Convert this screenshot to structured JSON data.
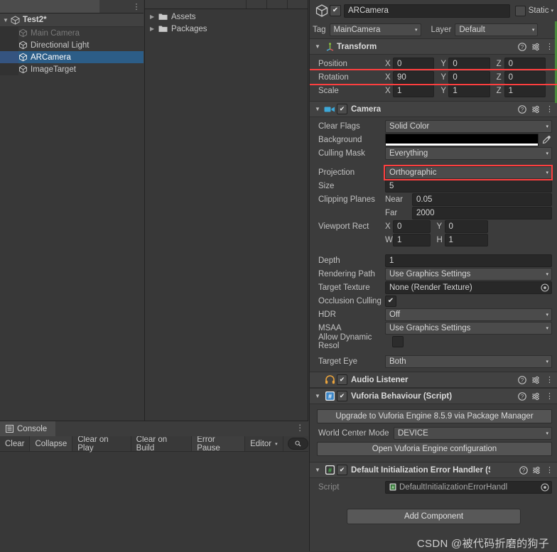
{
  "hierarchy": {
    "scene": {
      "name": "Test2*",
      "foldout": "▼",
      "icon": "unity-scene-icon",
      "menu": "⋮"
    },
    "items": [
      {
        "label": "Main Camera",
        "icon": "gameobject-cube-icon",
        "state": "disabled"
      },
      {
        "label": "Directional Light",
        "icon": "gameobject-cube-icon",
        "state": "normal"
      },
      {
        "label": "ARCamera",
        "icon": "gameobject-cube-icon",
        "state": "selected"
      },
      {
        "label": "ImageTarget",
        "icon": "gameobject-cube-icon",
        "state": "normal"
      }
    ]
  },
  "project": {
    "items": [
      {
        "label": "Assets",
        "arrow": "▶",
        "icon": "folder-icon"
      },
      {
        "label": "Packages",
        "arrow": "▶",
        "icon": "folder-icon"
      }
    ]
  },
  "console": {
    "tab_label": "Console",
    "tab_icon": "console-icon",
    "menu": "⋮",
    "buttons": [
      {
        "label": "Clear",
        "style": "flat"
      },
      {
        "label": "Collapse",
        "style": "raised"
      },
      {
        "label": "Clear on Play",
        "style": "flat"
      },
      {
        "label": "Clear on Build",
        "style": "flat"
      },
      {
        "label": "Error Pause",
        "style": "raised"
      },
      {
        "label": "Editor",
        "style": "flat",
        "caret": "▾"
      }
    ],
    "search_placeholder": "",
    "search_icon": "search-icon"
  },
  "inspector": {
    "gameobject": {
      "name": "ARCamera",
      "enabled_check": "✔",
      "icon": "gameobject-cube-icon",
      "static_label": "Static",
      "static_caret": "▾",
      "tag_label": "Tag",
      "tag_value": "MainCamera",
      "layer_label": "Layer",
      "layer_value": "Default",
      "caret": "▾"
    },
    "components": [
      {
        "name": "Transform",
        "icon": "transform-icon",
        "foldout": "▼",
        "has_enable_check": false,
        "help": "?",
        "preset": "preset-icon",
        "menu": "⋮",
        "rows": [
          {
            "type": "vector3",
            "label": "Position",
            "axes": [
              "X",
              "Y",
              "Z"
            ],
            "values": [
              "0",
              "0",
              "0"
            ],
            "highlight": false
          },
          {
            "type": "vector3",
            "label": "Rotation",
            "axes": [
              "X",
              "Y",
              "Z"
            ],
            "values": [
              "90",
              "0",
              "0"
            ],
            "highlight": true
          },
          {
            "type": "vector3",
            "label": "Scale",
            "axes": [
              "X",
              "Y",
              "Z"
            ],
            "values": [
              "1",
              "1",
              "1"
            ],
            "highlight": false
          }
        ]
      },
      {
        "name": "Camera",
        "icon": "camera-icon",
        "foldout": "▼",
        "has_enable_check": true,
        "enabled_check": "✔",
        "help": "?",
        "preset": "preset-icon",
        "menu": "⋮",
        "rows": [
          {
            "type": "dropdown",
            "label": "Clear Flags",
            "value": "Solid Color",
            "highlight": false
          },
          {
            "type": "color",
            "label": "Background",
            "value": "#000000",
            "eyedropper": "eyedropper-icon"
          },
          {
            "type": "dropdown",
            "label": "Culling Mask",
            "value": "Everything",
            "highlight": false
          },
          {
            "type": "gap"
          },
          {
            "type": "dropdown",
            "label": "Projection",
            "value": "Orthographic",
            "highlight": true
          },
          {
            "type": "text",
            "label": "Size",
            "value": "5"
          },
          {
            "type": "subfield",
            "label": "Clipping Planes",
            "sublabel": "Near",
            "value": "0.05"
          },
          {
            "type": "subfield",
            "label": "",
            "sublabel": "Far",
            "value": "2000"
          },
          {
            "type": "rect2",
            "label": "Viewport Rect",
            "axes": [
              "X",
              "Y"
            ],
            "values": [
              "0",
              "0"
            ]
          },
          {
            "type": "rect2",
            "label": "",
            "axes": [
              "W",
              "H"
            ],
            "values": [
              "1",
              "1"
            ]
          },
          {
            "type": "gap"
          },
          {
            "type": "text",
            "label": "Depth",
            "value": "1"
          },
          {
            "type": "dropdown",
            "label": "Rendering Path",
            "value": "Use Graphics Settings"
          },
          {
            "type": "object",
            "label": "Target Texture",
            "value": "None (Render Texture)"
          },
          {
            "type": "checkbox",
            "label": "Occlusion Culling",
            "checked": true,
            "check": "✔"
          },
          {
            "type": "dropdown",
            "label": "HDR",
            "value": "Off"
          },
          {
            "type": "dropdown",
            "label": "MSAA",
            "value": "Use Graphics Settings"
          },
          {
            "type": "checkbox",
            "label": "Allow Dynamic Resol",
            "checked": false,
            "check": ""
          },
          {
            "type": "gap"
          },
          {
            "type": "dropdown",
            "label": "Target Eye",
            "value": "Both"
          }
        ]
      },
      {
        "name": "Audio Listener",
        "icon": "headphones-icon",
        "foldout": "",
        "has_enable_check": true,
        "enabled_check": "✔",
        "help": "?",
        "preset": "preset-icon",
        "menu": "⋮",
        "rows": []
      },
      {
        "name": "Vuforia Behaviour (Script)",
        "icon": "csharp-script-icon",
        "foldout": "▼",
        "has_enable_check": true,
        "enabled_check": "✔",
        "help": "?",
        "preset": "preset-icon",
        "menu": "⋮",
        "rows": [
          {
            "type": "button",
            "label": "Upgrade to Vuforia Engine 8.5.9 via Package Manager"
          },
          {
            "type": "dropdown",
            "label": "World Center Mode",
            "value": "DEVICE"
          },
          {
            "type": "button",
            "label": "Open Vuforia Engine configuration"
          }
        ]
      },
      {
        "name": "Default Initialization Error Handler (Scr",
        "icon": "csharp-script-icon",
        "foldout": "▼",
        "has_enable_check": true,
        "enabled_check": "✔",
        "help": "?",
        "preset": "preset-icon",
        "menu": "⋮",
        "rows": [
          {
            "type": "object",
            "label": "Script",
            "value": "DefaultInitializationErrorHandl",
            "dim": true
          }
        ]
      }
    ],
    "add_component_label": "Add Component",
    "watermark": "CSDN @被代码折磨的狗子"
  },
  "colors": {
    "highlight": "#fd3f3f",
    "selection": "#2c5d87",
    "prefab_strip": "#4a8a3c",
    "panel_bg": "#3c3c3c",
    "field_bg": "#282828"
  }
}
